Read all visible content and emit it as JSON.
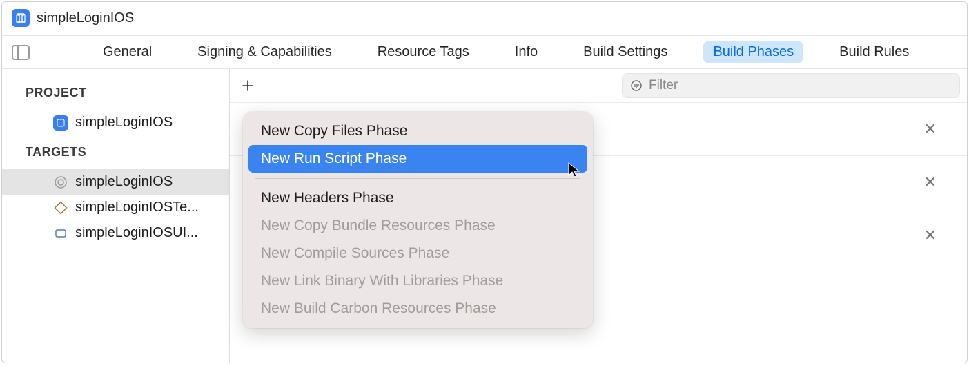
{
  "title": "simpleLoginIOS",
  "tabs": [
    {
      "label": "General"
    },
    {
      "label": "Signing & Capabilities"
    },
    {
      "label": "Resource Tags"
    },
    {
      "label": "Info"
    },
    {
      "label": "Build Settings"
    },
    {
      "label": "Build Phases",
      "active": true
    },
    {
      "label": "Build Rules"
    }
  ],
  "sidebar": {
    "project_label": "PROJECT",
    "project_item": "simpleLoginIOS",
    "targets_label": "TARGETS",
    "targets": [
      {
        "label": "simpleLoginIOS",
        "selected": true
      },
      {
        "label": "simpleLoginIOSTe..."
      },
      {
        "label": "simpleLoginIOSUI..."
      }
    ]
  },
  "filter_placeholder": "Filter",
  "menu": {
    "items": [
      {
        "label": "New Copy Files Phase",
        "enabled": true,
        "highlight": false
      },
      {
        "label": "New Run Script Phase",
        "enabled": true,
        "highlight": true
      },
      {
        "sep": true
      },
      {
        "label": "New Headers Phase",
        "enabled": true
      },
      {
        "label": "New Copy Bundle Resources Phase",
        "enabled": false
      },
      {
        "label": "New Compile Sources Phase",
        "enabled": false
      },
      {
        "label": "New Link Binary With Libraries Phase",
        "enabled": false
      },
      {
        "label": "New Build Carbon Resources Phase",
        "enabled": false
      }
    ]
  }
}
